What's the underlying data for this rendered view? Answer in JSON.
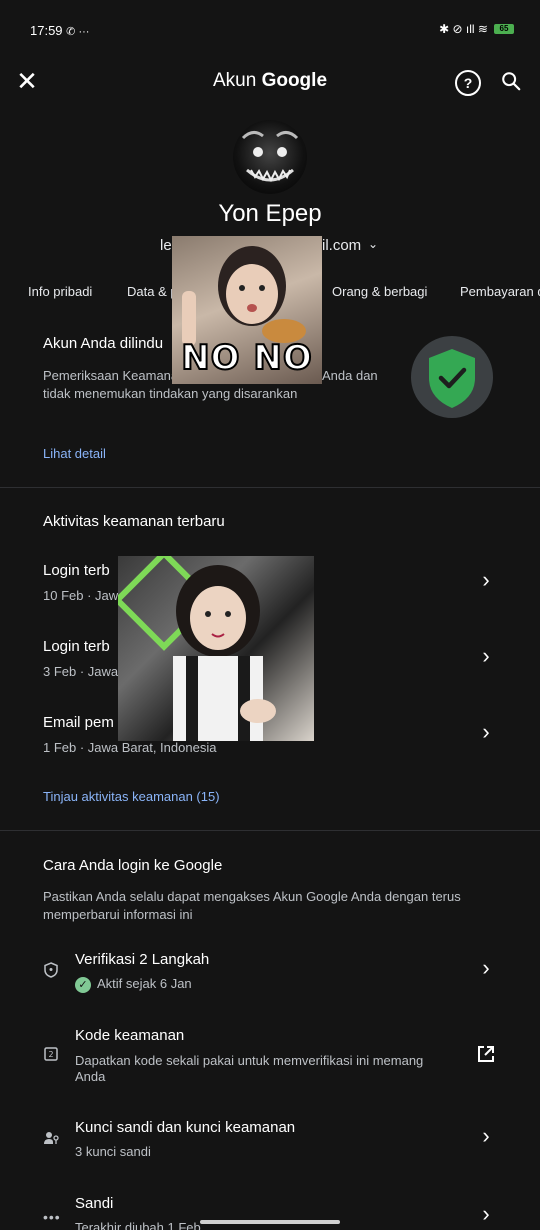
{
  "status_bar": {
    "time": "17:59",
    "left_icons": "✆ ···",
    "right_icons": "✱ ⊘ ıll ≋",
    "battery": "65"
  },
  "app_bar": {
    "title_part1": "Akun ",
    "title_part2": "Google",
    "close_icon": "close-icon",
    "help_icon": "help-icon",
    "search_icon": "search-icon"
  },
  "profile": {
    "name": "Yon Epep",
    "email_visible_start": "le",
    "email_visible_end": "il.com",
    "email_chevron": "⌄"
  },
  "tabs": [
    "Info pribadi",
    "Data & p",
    "Orang & berbagi",
    "Pembayaran d"
  ],
  "stickers": {
    "sticker1_text": "NO NO"
  },
  "protected": {
    "title": "Akun Anda dilindu",
    "desc_line1_start": "Pemeriksaan Keamana",
    "desc_line1_end": "Anda dan",
    "desc_line2": "tidak menemukan tindakan yang disarankan",
    "link": "Lihat detail"
  },
  "activity": {
    "title": "Aktivitas keamanan terbaru",
    "items": [
      {
        "title": "Login terb",
        "sub": "10 Feb · Jaw"
      },
      {
        "title": "Login terb",
        "sub": "3 Feb · Jawa"
      },
      {
        "title": "Email pem",
        "sub": "1 Feb · Jawa Barat, Indonesia"
      }
    ],
    "link": "Tinjau aktivitas keamanan (15)"
  },
  "login": {
    "title": "Cara Anda login ke Google",
    "desc_line1": "Pastikan Anda selalu dapat mengakses Akun Google Anda dengan terus",
    "desc_line2": "memperbarui informasi ini",
    "items": [
      {
        "title": "Verifikasi 2 Langkah",
        "sub": "Aktif sejak 6 Jan",
        "icon": "shield-icon"
      },
      {
        "title": "Kode keamanan",
        "sub_line1": "Dapatkan kode sekali pakai untuk memverifikasi ini memang",
        "sub_line2": "Anda",
        "icon": "code-icon"
      },
      {
        "title": "Kunci sandi dan kunci keamanan",
        "sub": "3 kunci sandi",
        "icon": "passkey-icon"
      },
      {
        "title": "Sandi",
        "sub": "Terakhir diubah 1 Feb",
        "icon": "password-icon"
      }
    ]
  },
  "colors": {
    "background": "#141414",
    "link": "#8ab4f8",
    "shield_green": "#34a853",
    "check_green": "#81c995"
  }
}
